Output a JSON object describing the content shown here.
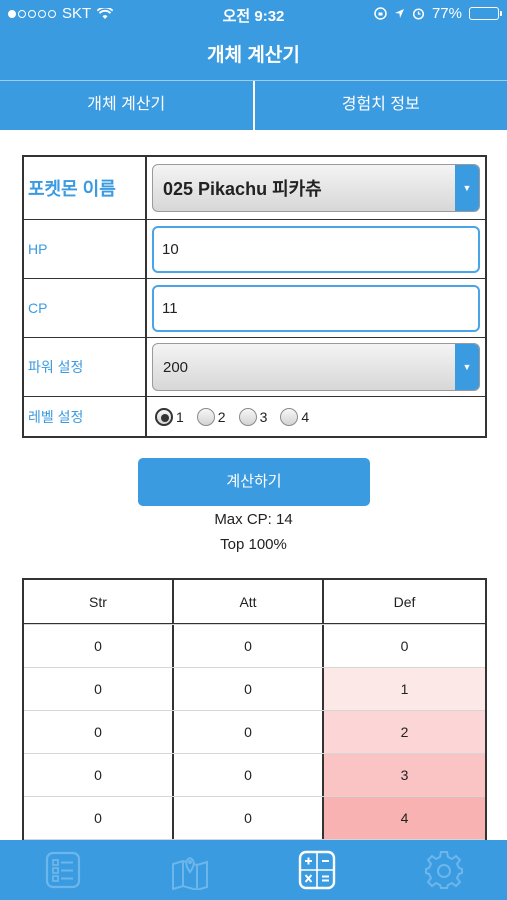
{
  "status_bar": {
    "carrier": "SKT",
    "time": "오전 9:32",
    "battery": "77%",
    "battery_level": 0.77
  },
  "header": {
    "title": "개체 계산기"
  },
  "tabs": [
    {
      "label": "개체 계산기"
    },
    {
      "label": "경험치 정보"
    }
  ],
  "form": {
    "pokemon_label": "포켓몬 이름",
    "pokemon_value": "025 Pikachu 피카츄",
    "hp_label": "HP",
    "hp_value": "10",
    "cp_label": "CP",
    "cp_value": "11",
    "power_label": "파워 설정",
    "power_value": "200",
    "level_label": "레벨 설정",
    "level_options": [
      "1",
      "2",
      "3",
      "4"
    ],
    "level_selected": "1"
  },
  "calc_button": "계산하기",
  "results": {
    "max_cp": "Max CP: 14",
    "top": "Top 100%"
  },
  "table": {
    "headers": [
      "Str",
      "Att",
      "Def"
    ],
    "rows": [
      [
        "0",
        "0",
        "0"
      ],
      [
        "0",
        "0",
        "1"
      ],
      [
        "0",
        "0",
        "2"
      ],
      [
        "0",
        "0",
        "3"
      ],
      [
        "0",
        "0",
        "4"
      ]
    ]
  },
  "bottom_tabs": [
    {
      "icon": "list-icon",
      "active": false
    },
    {
      "icon": "map-icon",
      "active": false
    },
    {
      "icon": "calculator-icon",
      "active": true
    },
    {
      "icon": "gear-icon",
      "active": false
    }
  ],
  "colors": {
    "accent": "#3a9be1",
    "text": "#222222",
    "label": "#3a9be1"
  }
}
